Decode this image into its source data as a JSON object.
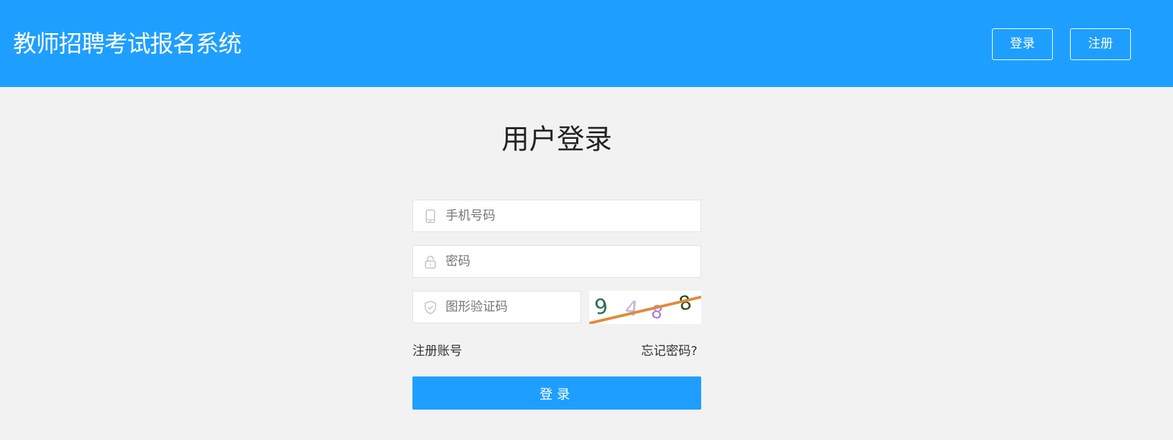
{
  "header": {
    "title": "教师招聘考试报名系统",
    "login_label": "登录",
    "register_label": "注册",
    "background_color": "#1e9fff"
  },
  "form": {
    "title": "用户登录",
    "phone_placeholder": "手机号码",
    "password_placeholder": "密码",
    "captcha_placeholder": "图形验证码",
    "captcha_code": "9488",
    "register_link": "注册账号",
    "forgot_link": "忘记密码?",
    "submit_label": "登录"
  },
  "icons": {
    "phone": "mobile-phone-icon",
    "password": "lock-icon",
    "captcha": "shield-check-icon"
  }
}
